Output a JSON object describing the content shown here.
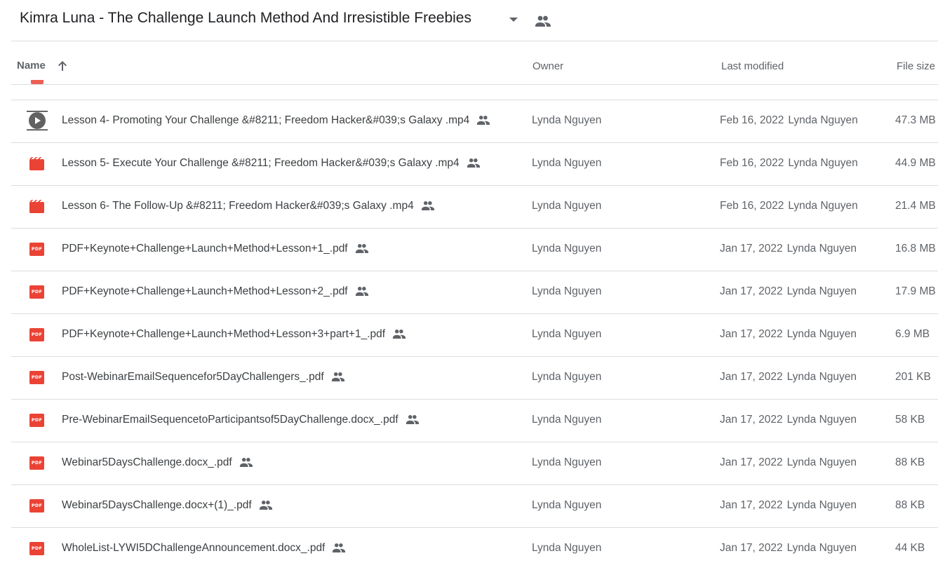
{
  "folder": {
    "title": "Kimra Luna - The Challenge Launch Method And Irresistible Freebies"
  },
  "columns": {
    "name": "Name",
    "owner": "Owner",
    "modified": "Last modified",
    "size": "File size"
  },
  "files": [
    {
      "name": "Lesson 4- Promoting Your Challenge &#8211; Freedom Hacker&#039;s Galaxy .mp4",
      "type": "video-thumb",
      "owner": "Lynda Nguyen",
      "date": "Feb 16, 2022",
      "by": "Lynda Nguyen",
      "size": "47.3 MB"
    },
    {
      "name": "Lesson 5- Execute Your Challenge &#8211; Freedom Hacker&#039;s Galaxy .mp4",
      "type": "video",
      "owner": "Lynda Nguyen",
      "date": "Feb 16, 2022",
      "by": "Lynda Nguyen",
      "size": "44.9 MB"
    },
    {
      "name": "Lesson 6- The Follow-Up &#8211; Freedom Hacker&#039;s Galaxy .mp4",
      "type": "video",
      "owner": "Lynda Nguyen",
      "date": "Feb 16, 2022",
      "by": "Lynda Nguyen",
      "size": "21.4 MB"
    },
    {
      "name": "PDF+Keynote+Challenge+Launch+Method+Lesson+1_.pdf",
      "type": "pdf",
      "owner": "Lynda Nguyen",
      "date": "Jan 17, 2022",
      "by": "Lynda Nguyen",
      "size": "16.8 MB"
    },
    {
      "name": "PDF+Keynote+Challenge+Launch+Method+Lesson+2_.pdf",
      "type": "pdf",
      "owner": "Lynda Nguyen",
      "date": "Jan 17, 2022",
      "by": "Lynda Nguyen",
      "size": "17.9 MB"
    },
    {
      "name": "PDF+Keynote+Challenge+Launch+Method+Lesson+3+part+1_.pdf",
      "type": "pdf",
      "owner": "Lynda Nguyen",
      "date": "Jan 17, 2022",
      "by": "Lynda Nguyen",
      "size": "6.9 MB"
    },
    {
      "name": "Post-WebinarEmailSequencefor5DayChallengers_.pdf",
      "type": "pdf",
      "owner": "Lynda Nguyen",
      "date": "Jan 17, 2022",
      "by": "Lynda Nguyen",
      "size": "201 KB"
    },
    {
      "name": "Pre-WebinarEmailSequencetoParticipantsof5DayChallenge.docx_.pdf",
      "type": "pdf",
      "owner": "Lynda Nguyen",
      "date": "Jan 17, 2022",
      "by": "Lynda Nguyen",
      "size": "58 KB"
    },
    {
      "name": "Webinar5DaysChallenge.docx_.pdf",
      "type": "pdf",
      "owner": "Lynda Nguyen",
      "date": "Jan 17, 2022",
      "by": "Lynda Nguyen",
      "size": "88 KB"
    },
    {
      "name": "Webinar5DaysChallenge.docx+(1)_.pdf",
      "type": "pdf",
      "owner": "Lynda Nguyen",
      "date": "Jan 17, 2022",
      "by": "Lynda Nguyen",
      "size": "88 KB"
    },
    {
      "name": "WholeList-LYWI5DChallengeAnnouncement.docx_.pdf",
      "type": "pdf",
      "owner": "Lynda Nguyen",
      "date": "Jan 17, 2022",
      "by": "Lynda Nguyen",
      "size": "44 KB"
    }
  ],
  "icons": {
    "pdf_label": "PDF",
    "folder_shared": "people-icon",
    "sort": "arrow-up-icon",
    "dropdown": "caret-down-icon",
    "video": "video-file-icon",
    "pdf": "pdf-file-icon"
  },
  "colors": {
    "pdf_red": "#ea4335",
    "text": "#3c4043",
    "secondary": "#5f6368",
    "divider": "#dadce0"
  }
}
